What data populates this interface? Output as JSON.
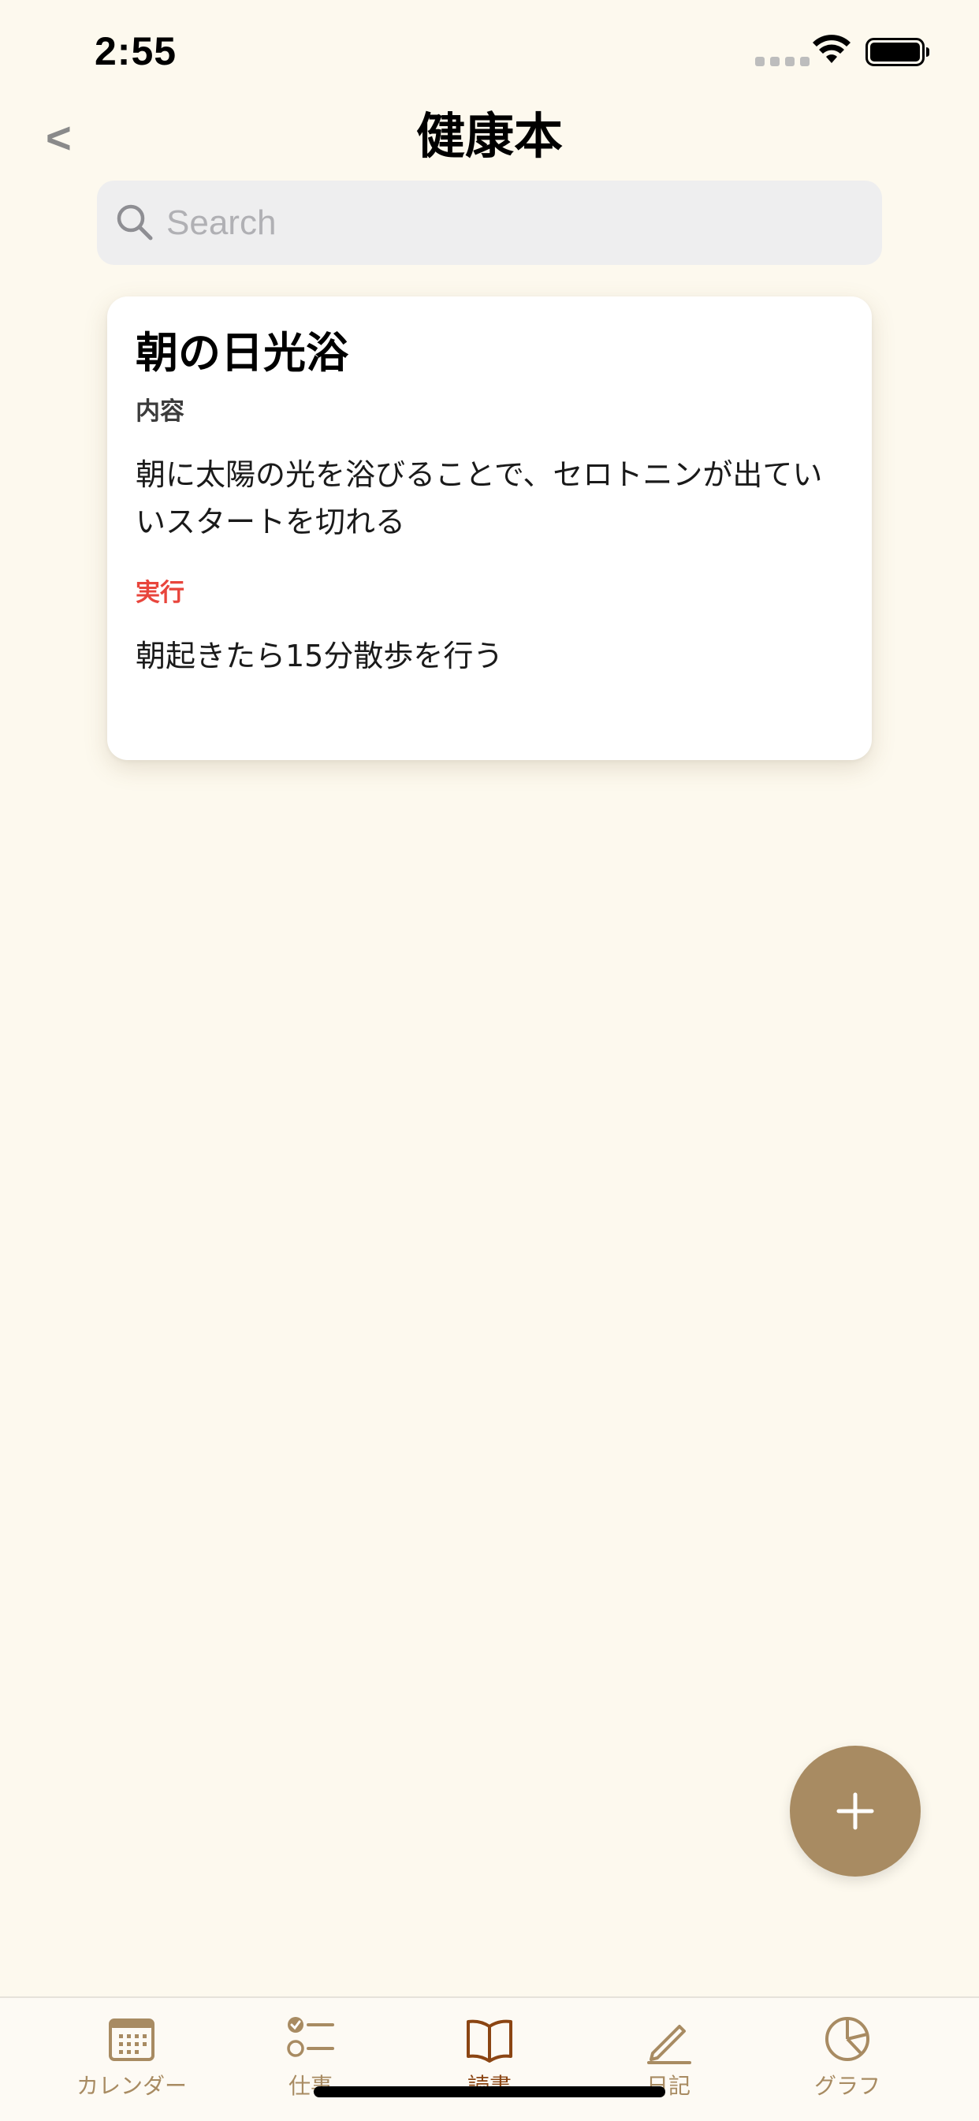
{
  "status_bar": {
    "time": "2:55"
  },
  "nav": {
    "back_label": "<",
    "title": "健康本"
  },
  "search": {
    "placeholder": "Search",
    "value": ""
  },
  "cards": [
    {
      "title": "朝の日光浴",
      "content_label": "内容",
      "content_text": "朝に太陽の光を浴びることで、セロトニンが出ていいスタートを切れる",
      "action_label": "実行",
      "action_text": "朝起きたら15分散歩を行う"
    }
  ],
  "fab": {
    "icon": "plus-icon"
  },
  "tab_bar": {
    "items": [
      {
        "label": "カレンダー",
        "icon": "calendar-icon",
        "active": false
      },
      {
        "label": "仕事",
        "icon": "checklist-icon",
        "active": false
      },
      {
        "label": "読書",
        "icon": "book-icon",
        "active": true
      },
      {
        "label": "日記",
        "icon": "pencil-icon",
        "active": false
      },
      {
        "label": "グラフ",
        "icon": "pie-chart-icon",
        "active": false
      }
    ]
  },
  "colors": {
    "background": "#FDF9EE",
    "accent": "#A88B62",
    "active_tab": "#8B4513",
    "action_label": "#E8453C",
    "card": "#FFFFFF",
    "search_bg": "#EEEEEF"
  }
}
